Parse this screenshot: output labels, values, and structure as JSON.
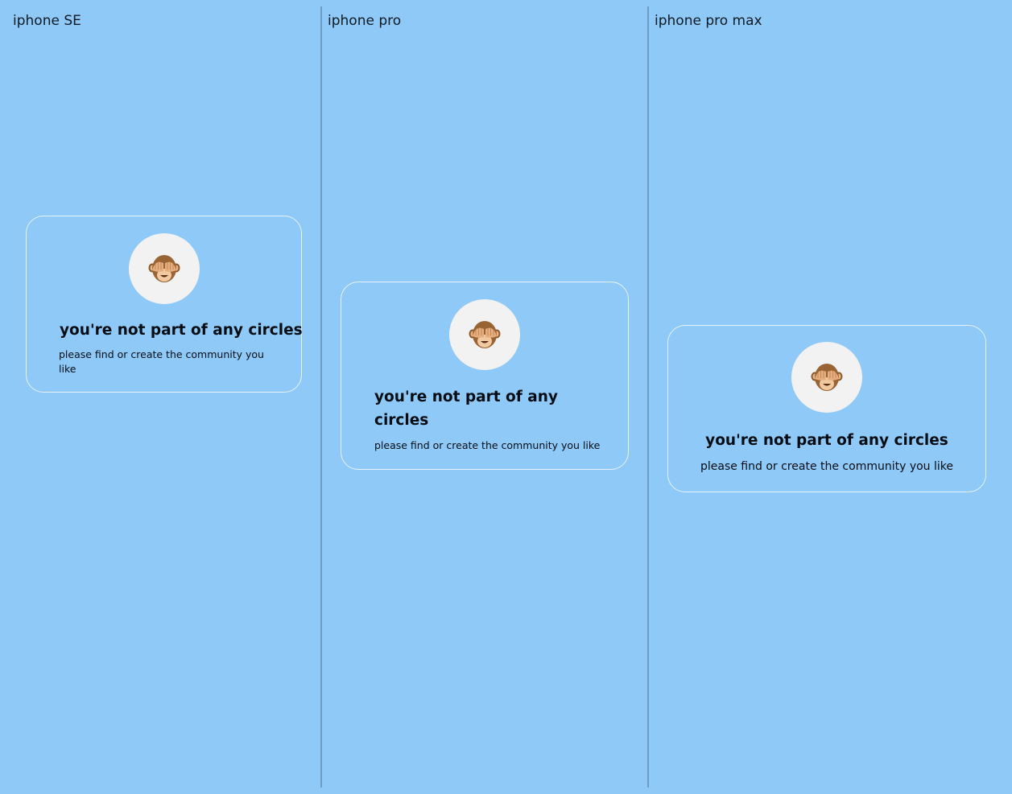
{
  "columns": [
    {
      "label": "iphone SE",
      "card": {
        "icon": "see-no-evil-monkey-icon",
        "title": "you're not part of any circles",
        "subtitle": "please find or create the community you like"
      }
    },
    {
      "label": "iphone pro",
      "card": {
        "icon": "see-no-evil-monkey-icon",
        "title": "you're not part of any circles",
        "subtitle": "please find or create the community you like"
      }
    },
    {
      "label": "iphone pro max",
      "card": {
        "icon": "see-no-evil-monkey-icon",
        "title": "you're not part of any circles",
        "subtitle": "please find or create the community you like"
      }
    }
  ],
  "colors": {
    "background": "#8fc9f7",
    "divider": "#6e9ec6",
    "card_border": "#e7f2fc",
    "avatar_background": "#f2f2f2"
  }
}
